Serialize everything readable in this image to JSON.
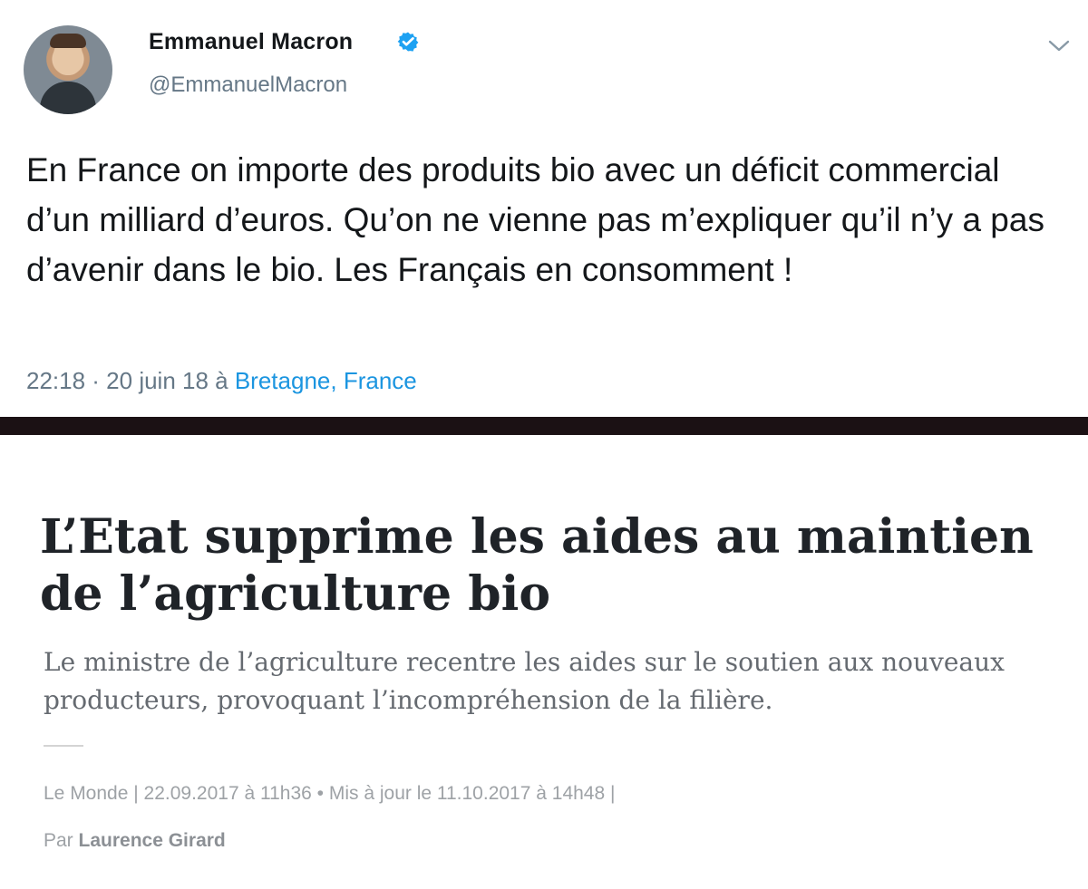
{
  "tweet": {
    "author_name": "Emmanuel Macron",
    "handle": "@EmmanuelMacron",
    "text": "En France on importe des produits bio avec un déficit commercial d’un milliard d’euros. Qu’on ne vienne pas m’expliquer qu’il n’y a pas d’avenir dans le bio. Les Français en consomment !",
    "time": "22:18 · 20 juin 18 à ",
    "location": "Bretagne, France",
    "verified_color": "#1da1f2",
    "accent_color": "#1b95e0",
    "icons": [
      "avatar",
      "verified-badge-icon",
      "chevron-down-icon"
    ]
  },
  "article": {
    "headline": "L’Etat supprime les aides au maintien de l’agriculture bio",
    "lede": "Le ministre de l’agriculture recentre les aides sur le soutien aux nouveaux producteurs, provoquant l’incompréhension de la filière.",
    "meta": "Le Monde | 22.09.2017 à 11h36 • Mis à jour le 11.10.2017 à 14h48 |",
    "author_prefix": "Par ",
    "author_name": "Laurence Girard"
  }
}
